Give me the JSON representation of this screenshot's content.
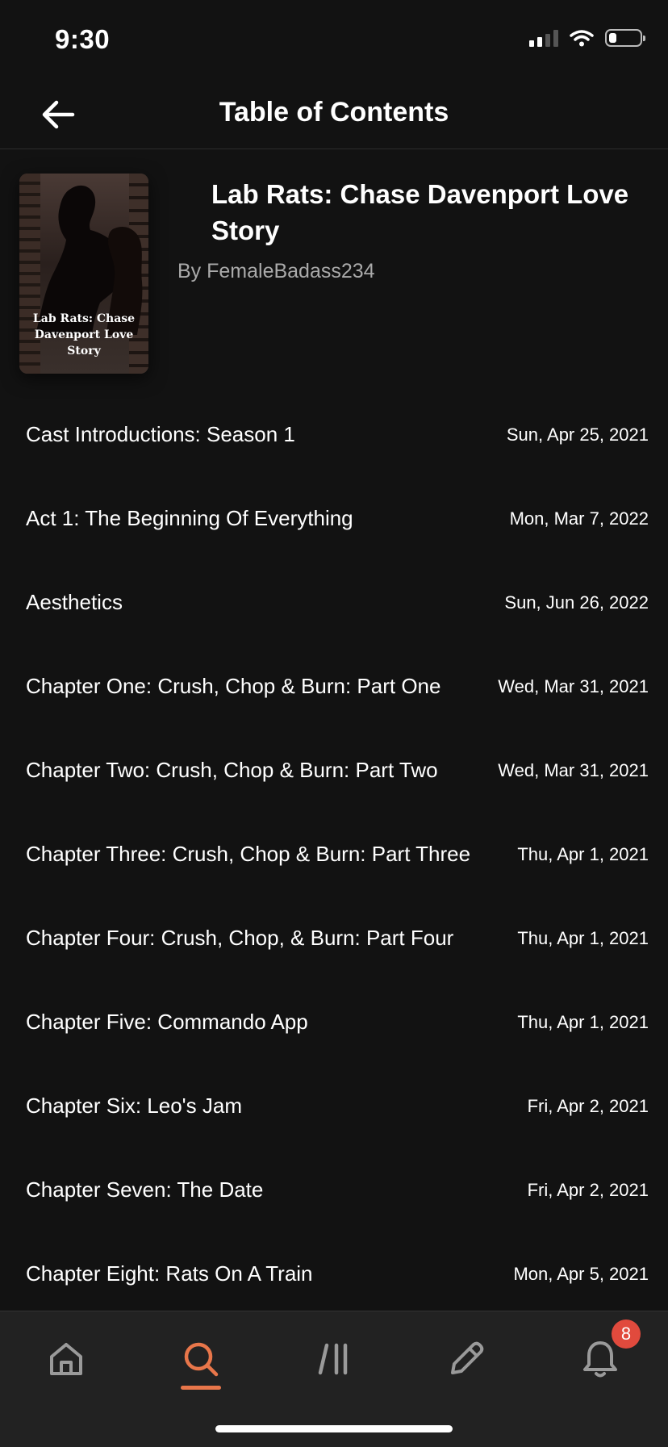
{
  "status_bar": {
    "time": "9:30"
  },
  "header": {
    "title": "Table of Contents"
  },
  "story": {
    "cover_text": "Lab Rats: Chase Davenport Love Story",
    "title": "Lab Rats: Chase Davenport Love Story",
    "author": "By FemaleBadass234"
  },
  "chapters": [
    {
      "title": "Cast Introductions: Season 1",
      "date": "Sun, Apr 25, 2021"
    },
    {
      "title": "Act 1: The Beginning Of Everything",
      "date": "Mon, Mar 7, 2022"
    },
    {
      "title": "Aesthetics",
      "date": "Sun, Jun 26, 2022"
    },
    {
      "title": "Chapter One: Crush, Chop & Burn: Part One",
      "date": "Wed, Mar 31, 2021"
    },
    {
      "title": "Chapter Two: Crush, Chop & Burn: Part Two",
      "date": "Wed, Mar 31, 2021"
    },
    {
      "title": "Chapter Three: Crush, Chop & Burn: Part Three",
      "date": "Thu, Apr 1, 2021"
    },
    {
      "title": "Chapter Four: Crush, Chop, & Burn: Part Four",
      "date": "Thu, Apr 1, 2021"
    },
    {
      "title": "Chapter Five: Commando App",
      "date": "Thu, Apr 1, 2021"
    },
    {
      "title": "Chapter Six: Leo's Jam",
      "date": "Fri, Apr 2, 2021"
    },
    {
      "title": "Chapter Seven: The Date",
      "date": "Fri, Apr 2, 2021"
    },
    {
      "title": "Chapter Eight: Rats On A Train",
      "date": "Mon, Apr 5, 2021"
    }
  ],
  "bottom_nav": {
    "items": [
      "home-icon",
      "search-icon",
      "library-icon",
      "write-icon",
      "notifications-icon"
    ],
    "active": "search-icon",
    "notification_count": "8"
  },
  "colors": {
    "accent": "#e8764a",
    "badge": "#e14a3d",
    "background": "#121212",
    "nav_background": "#222222"
  }
}
